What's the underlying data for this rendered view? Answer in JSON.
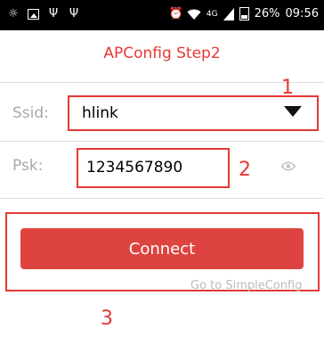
{
  "status_bar": {
    "battery": "26%",
    "time": "09:56",
    "network": "4G",
    "icons": [
      "brightness-icon",
      "image-icon",
      "usb-icon",
      "usb-icon",
      "alarm-icon",
      "wifi-icon",
      "signal-icon",
      "battery-icon"
    ]
  },
  "header": {
    "title": "APConfig Step2"
  },
  "form": {
    "ssid_label": "Ssid:",
    "ssid_value": "hlink",
    "psk_label": "Psk:",
    "psk_value": "1234567890"
  },
  "actions": {
    "connect_label": "Connect",
    "simpleconfig_link": "Go to SimpleConfig"
  },
  "annotations": {
    "one": "1",
    "two": "2",
    "three": "3"
  },
  "colors": {
    "accent": "#e53935",
    "button": "#dd4440",
    "label_gray": "#a9a9a9",
    "divider": "#dcdcdc"
  }
}
